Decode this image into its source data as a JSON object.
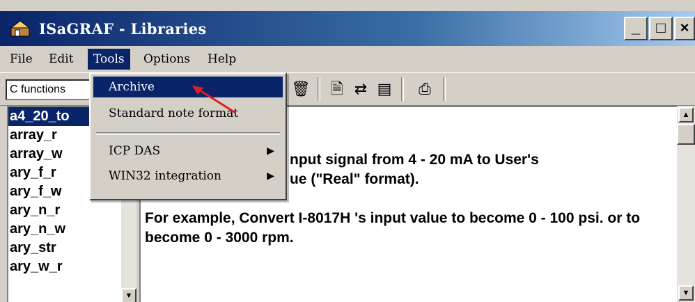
{
  "window": {
    "title": "ISaGRAF - Libraries",
    "controls": {
      "minimize": "_",
      "maximize": "□",
      "close": "×"
    }
  },
  "menubar": {
    "items": [
      {
        "label": "File"
      },
      {
        "label": "Edit"
      },
      {
        "label": "Tools"
      },
      {
        "label": "Options"
      },
      {
        "label": "Help"
      }
    ]
  },
  "toolbar": {
    "combo_value": "C functions",
    "icons": [
      "trash-icon",
      "document-icon",
      "exchange-icon",
      "card-icon",
      "printer-icon"
    ]
  },
  "tools_menu": {
    "items": [
      {
        "label": "Archive"
      },
      {
        "label": "Standard note format"
      },
      {
        "label": "ICP DAS",
        "submenu": "▶"
      },
      {
        "label": "WIN32 integration",
        "submenu": "▶"
      }
    ]
  },
  "library_list": {
    "items": [
      "a4_20_to",
      "array_r",
      "array_w",
      "ary_f_r",
      "ary_f_w",
      "ary_n_r",
      "ary_n_w",
      "ary_str",
      "ary_w_r"
    ]
  },
  "description": {
    "line1": "nput signal from 4 - 20 mA to User's",
    "line2": "ue (\"Real\" format).",
    "para2": "For example, Convert I-8017H 's input value to become 0 - 100 psi. or to become 0 - 3000 rpm."
  },
  "colors": {
    "selection": "#0a246a",
    "annotation_arrow": "#e02020"
  }
}
